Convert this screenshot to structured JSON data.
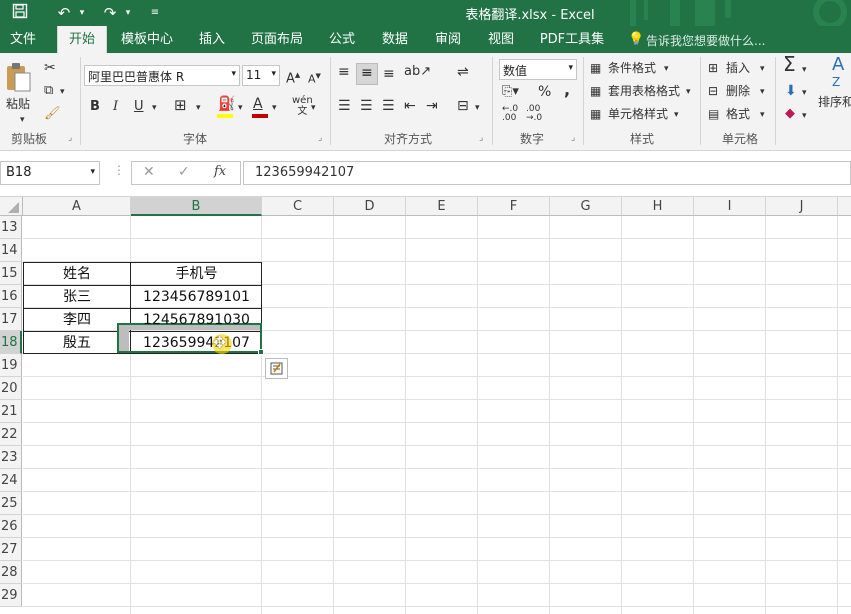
{
  "app": {
    "window_title": "表格翻译.xlsx - Excel",
    "qat": {
      "save_icon": "save-icon",
      "undo_icon": "undo-icon",
      "redo_icon": "redo-icon",
      "customize_icon": "customize-qat-icon"
    }
  },
  "tabs": [
    {
      "label": "文件"
    },
    {
      "label": "开始"
    },
    {
      "label": "模板中心"
    },
    {
      "label": "插入"
    },
    {
      "label": "页面布局"
    },
    {
      "label": "公式"
    },
    {
      "label": "数据"
    },
    {
      "label": "审阅"
    },
    {
      "label": "视图"
    },
    {
      "label": "PDF工具集"
    }
  ],
  "tell_me": "告诉我您想要做什么...",
  "ribbon": {
    "clipboard": {
      "paste": "粘贴",
      "label": "剪贴板"
    },
    "font": {
      "name": "阿里巴巴普惠体 R",
      "size": "11",
      "label": "字体",
      "bold": "B",
      "italic": "I",
      "underline": "U",
      "wen": "wén"
    },
    "alignment": {
      "label": "对齐方式"
    },
    "number": {
      "format": "数值",
      "label": "数字",
      "percent": "%",
      "comma": ","
    },
    "styles": {
      "conditional": "条件格式",
      "table": "套用表格格式",
      "cell": "单元格样式",
      "label": "样式"
    },
    "cells": {
      "insert": "插入",
      "delete": "删除",
      "format": "格式",
      "label": "单元格"
    },
    "editing": {
      "sort": "排序和"
    }
  },
  "formula_bar": {
    "name_box": "B18",
    "fx": "fx",
    "value": "123659942107"
  },
  "columns": [
    "A",
    "B",
    "C",
    "D",
    "E",
    "F",
    "G",
    "H",
    "I",
    "J"
  ],
  "rows": [
    "13",
    "14",
    "15",
    "16",
    "17",
    "18",
    "19",
    "20",
    "21",
    "22",
    "23",
    "24",
    "25",
    "26",
    "27",
    "28",
    "29"
  ],
  "table": {
    "header": {
      "a": "姓名",
      "b": "手机号"
    },
    "rows": [
      {
        "a": "张三",
        "b": "123456789101"
      },
      {
        "a": "李四",
        "b": "124567891030"
      },
      {
        "a": "殷五",
        "b": "123659942107"
      }
    ]
  },
  "selected_cell": "B18"
}
